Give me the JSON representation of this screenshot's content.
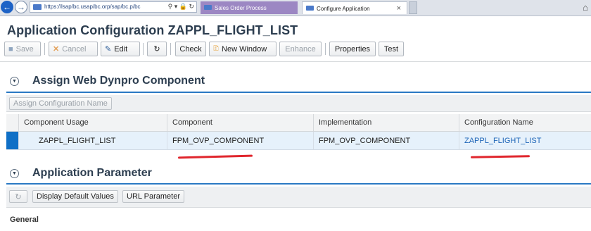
{
  "browser": {
    "address": "https://lsap/bc.usap/bc.orp/sap/bc.p/bc",
    "tabs": [
      {
        "label": "Sales Order Process"
      },
      {
        "label": "Configure Application"
      }
    ],
    "tab_close": "×"
  },
  "page": {
    "title": "Application Configuration ZAPPL_FLIGHT_LIST"
  },
  "toolbar": {
    "save": "Save",
    "cancel": "Cancel",
    "edit": "Edit",
    "refresh": "↻",
    "check": "Check",
    "new_window": "New Window",
    "enhance": "Enhance",
    "properties": "Properties",
    "test": "Test"
  },
  "assign_section": {
    "title": "Assign Web Dynpro Component",
    "button": "Assign Configuration Name",
    "columns": [
      "Component Usage",
      "Component",
      "Implementation",
      "Configuration Name"
    ],
    "rows": [
      {
        "usage": "ZAPPL_FLIGHT_LIST",
        "component": "FPM_OVP_COMPONENT",
        "implementation": "FPM_OVP_COMPONENT",
        "config_name": "ZAPPL_FLIGHT_LIST"
      }
    ]
  },
  "param_section": {
    "title": "Application Parameter",
    "refresh": "↻",
    "display_defaults": "Display Default Values",
    "url_param": "URL Parameter",
    "general_label": "General"
  },
  "colors": {
    "accent": "#2a79c4",
    "selected_row": "#e6f1fb",
    "row_marker": "#0f6fc6",
    "link": "#1f66b8",
    "annotation": "#e0262d"
  }
}
